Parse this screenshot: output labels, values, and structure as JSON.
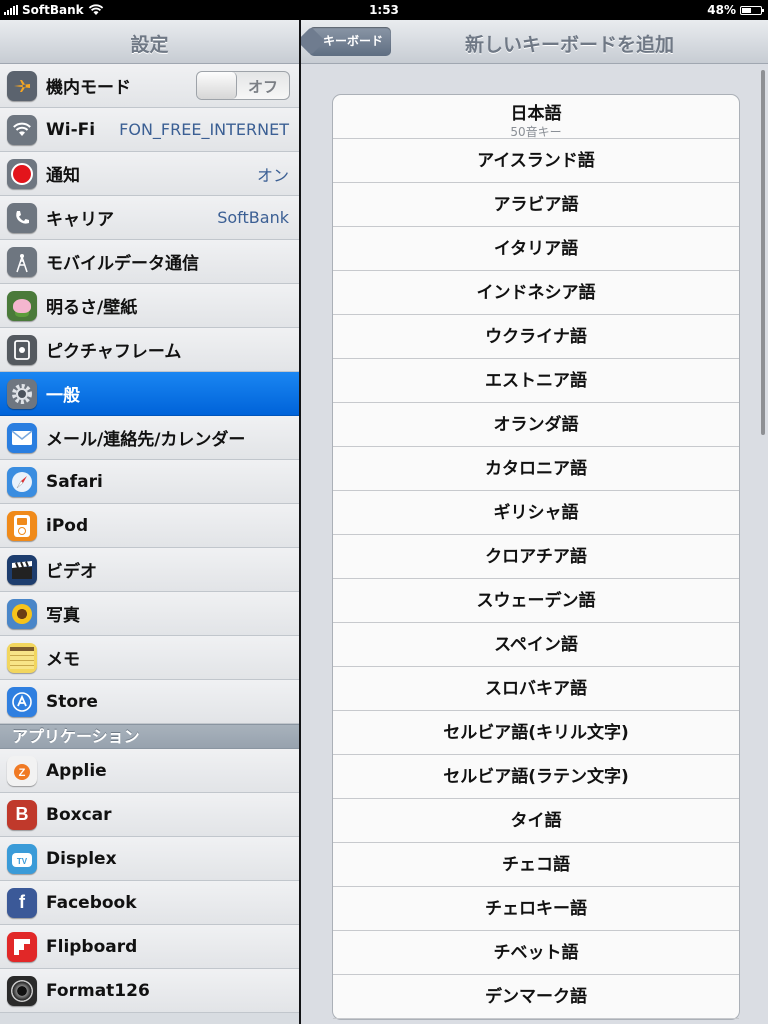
{
  "status_bar": {
    "carrier": "SoftBank",
    "time": "1:53",
    "battery_percent": "48%",
    "battery_level": 0.48
  },
  "master": {
    "title": "設定",
    "settings": [
      {
        "label": "機内モード",
        "toggle": "オフ",
        "icon": "airplane-icon",
        "color": "#5b636e"
      },
      {
        "label": "Wi-Fi",
        "value": "FON_FREE_INTERNET",
        "icon": "wifi-icon",
        "color": "#6e7680"
      },
      {
        "label": "通知",
        "value": "オン",
        "icon": "notifications-icon",
        "color": "#6e7680"
      },
      {
        "label": "キャリア",
        "value": "SoftBank",
        "icon": "phone-icon",
        "color": "#6e7680"
      },
      {
        "label": "モバイルデータ通信",
        "icon": "antenna-icon",
        "color": "#6e7680"
      },
      {
        "label": "明るさ/壁紙",
        "icon": "flower-icon",
        "color": "#4a7a3a"
      },
      {
        "label": "ピクチャフレーム",
        "icon": "picture-frame-icon",
        "color": "#54595f"
      },
      {
        "label": "一般",
        "icon": "gear-icon",
        "color": "#6e7680",
        "selected": true
      },
      {
        "label": "メール/連絡先/カレンダー",
        "icon": "mail-icon",
        "color": "#2a7ee0"
      },
      {
        "label": "Safari",
        "icon": "compass-icon",
        "color": "#3a8de0"
      },
      {
        "label": "iPod",
        "icon": "ipod-icon",
        "color": "#f08a1a"
      },
      {
        "label": "ビデオ",
        "icon": "clapperboard-icon",
        "color": "#1d3d6e"
      },
      {
        "label": "写真",
        "icon": "sunflower-icon",
        "color": "#4a86c8"
      },
      {
        "label": "メモ",
        "icon": "notepad-icon",
        "color": "#f2d65e"
      },
      {
        "label": "Store",
        "icon": "app-store-icon",
        "color": "#2f7fe0"
      }
    ],
    "section_header": "アプリケーション",
    "apps": [
      {
        "label": "Applie",
        "icon": "applie-icon",
        "color": "#f2f2f2"
      },
      {
        "label": "Boxcar",
        "icon": "boxcar-icon",
        "color": "#c0392b",
        "glyph": "B"
      },
      {
        "label": "Displex",
        "icon": "tv-icon",
        "color": "#3a9bd8"
      },
      {
        "label": "Facebook",
        "icon": "facebook-icon",
        "color": "#3b5998",
        "glyph": "f"
      },
      {
        "label": "Flipboard",
        "icon": "flipboard-icon",
        "color": "#e12828"
      },
      {
        "label": "Format126",
        "icon": "camera-lens-icon",
        "color": "#2a2a2a"
      }
    ]
  },
  "detail": {
    "back_label": "キーボード",
    "title": "新しいキーボードを追加",
    "first": {
      "label": "日本語",
      "subtitle": "50音キー"
    },
    "languages": [
      "アイスランド語",
      "アラビア語",
      "イタリア語",
      "インドネシア語",
      "ウクライナ語",
      "エストニア語",
      "オランダ語",
      "カタロニア語",
      "ギリシャ語",
      "クロアチア語",
      "スウェーデン語",
      "スペイン語",
      "スロバキア語",
      "セルビア語(キリル文字)",
      "セルビア語(ラテン文字)",
      "タイ語",
      "チェコ語",
      "チェロキー語",
      "チベット語",
      "デンマーク語"
    ]
  }
}
